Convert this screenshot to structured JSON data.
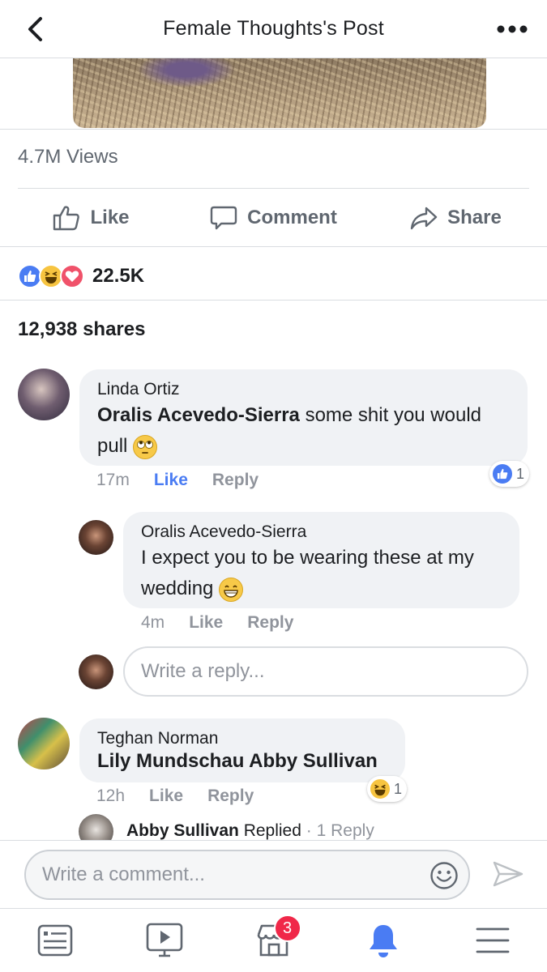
{
  "header": {
    "title": "Female Thoughts's Post",
    "back_icon": "back-chevron-icon",
    "more_icon": "more-dots-icon"
  },
  "post": {
    "views": "4.7M Views",
    "actions": {
      "like": "Like",
      "comment": "Comment",
      "share": "Share"
    },
    "reactions_count": "22.5K",
    "shares": "12,938 shares",
    "reaction_icons": [
      "like-reaction-icon",
      "haha-reaction-icon",
      "love-reaction-icon"
    ]
  },
  "comments": [
    {
      "author": "Linda Ortiz",
      "mention": "Oralis Acevedo-Sierra",
      "text": " some shit you would pull",
      "time": "17m",
      "like_label": "Like",
      "reply_label": "Reply",
      "reaction_count": "1",
      "reaction_icon": "like-reaction-icon",
      "emoji": "eye-roll-emoji"
    },
    {
      "author": "Oralis Acevedo-Sierra",
      "text": "I expect you to be wearing these at my wedding",
      "time": "4m",
      "like_label": "Like",
      "reply_label": "Reply",
      "emoji": "grin-emoji"
    },
    {
      "author": "Teghan Norman",
      "mentions": "Lily Mundschau Abby Sullivan",
      "time": "12h",
      "like_label": "Like",
      "reply_label": "Reply",
      "reaction_count": "1",
      "reaction_icon": "haha-reaction-icon"
    }
  ],
  "reply_input": {
    "placeholder": "Write a reply..."
  },
  "replied": {
    "name": "Abby Sullivan",
    "action": "Replied",
    "separator": "·",
    "count": "1 Reply"
  },
  "comment_bar": {
    "placeholder": "Write a comment..."
  },
  "tabbar": {
    "items": [
      {
        "icon": "news-feed-icon"
      },
      {
        "icon": "watch-icon"
      },
      {
        "icon": "marketplace-icon",
        "badge": "3"
      },
      {
        "icon": "notifications-bell-icon",
        "active": true
      },
      {
        "icon": "menu-icon"
      }
    ]
  },
  "colors": {
    "accent": "#4a7cf3",
    "text": "#1c1e21",
    "muted": "#606770",
    "bubble": "#f0f2f5",
    "badge": "#f02849"
  }
}
